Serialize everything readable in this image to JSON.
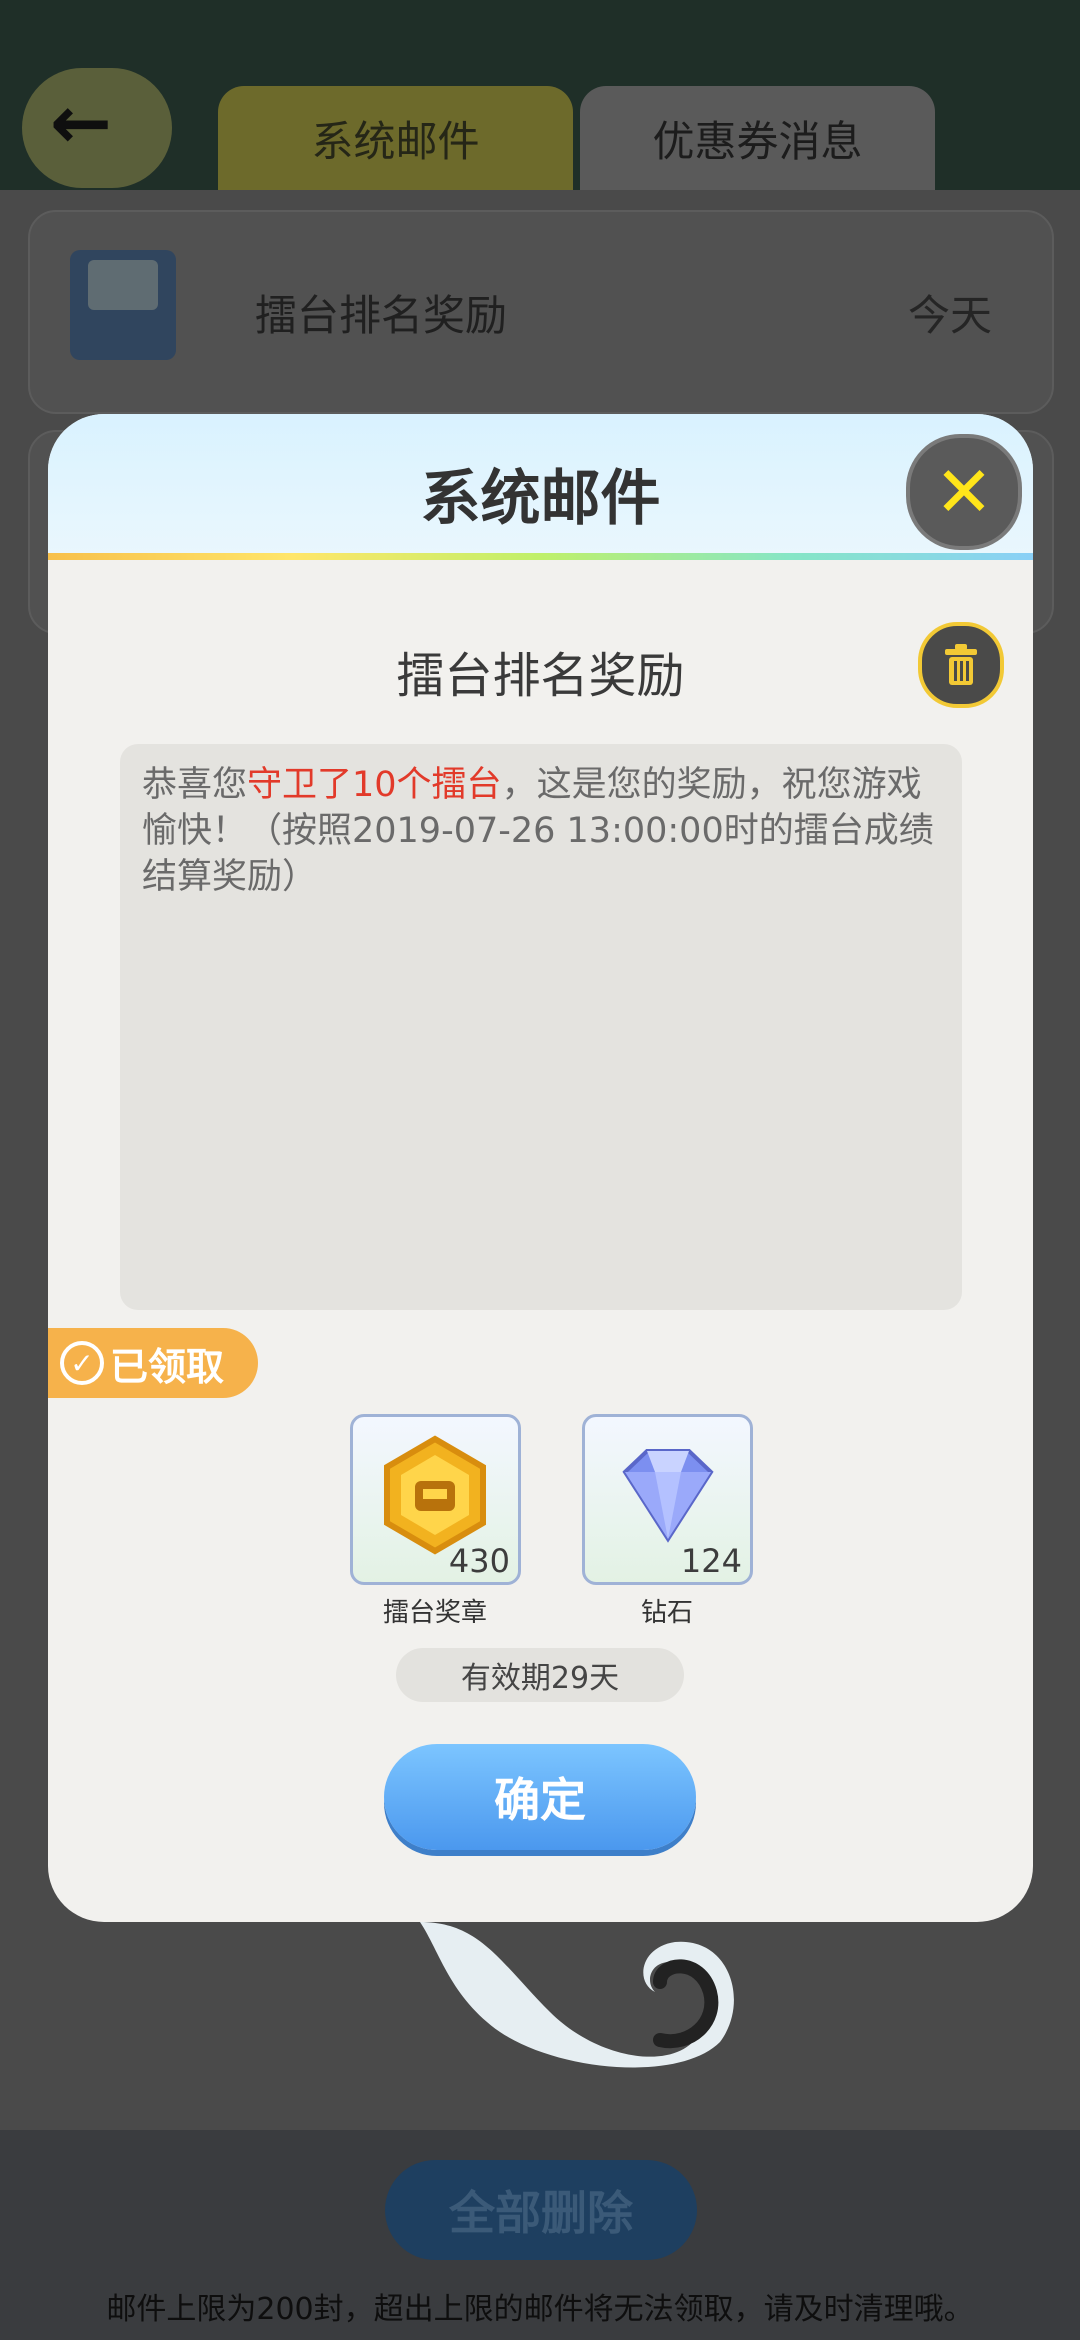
{
  "tabs": [
    {
      "label": "系统邮件",
      "active": true
    },
    {
      "label": "优惠券消息",
      "active": false
    }
  ],
  "list": {
    "items": [
      {
        "title": "擂台排名奖励",
        "date": "今天"
      }
    ]
  },
  "footer": {
    "delete_all_label": "全部删除",
    "note": "邮件上限为200封，超出上限的邮件将无法领取，请及时清理哦。"
  },
  "modal": {
    "title": "系统邮件",
    "mail_title": "擂台排名奖励",
    "content": {
      "part1": "恭喜您",
      "highlight": "守卫了10个擂台",
      "part2": "，这是您的奖励，祝您游戏愉快！（按照2019-07-26 13:00:00时的擂台成绩结算奖励）"
    },
    "claimed_label": "已领取",
    "rewards": [
      {
        "name": "擂台奖章",
        "count": "430",
        "icon": "medal-icon"
      },
      {
        "name": "钻石",
        "count": "124",
        "icon": "diamond-icon"
      }
    ],
    "validity": "有效期29天",
    "confirm_label": "确定"
  },
  "colors": {
    "accent_yellow": "#f2c935",
    "confirm_blue": "#4b98ee",
    "highlight_red": "#e23a2a",
    "claimed_orange": "#f6b24b"
  }
}
